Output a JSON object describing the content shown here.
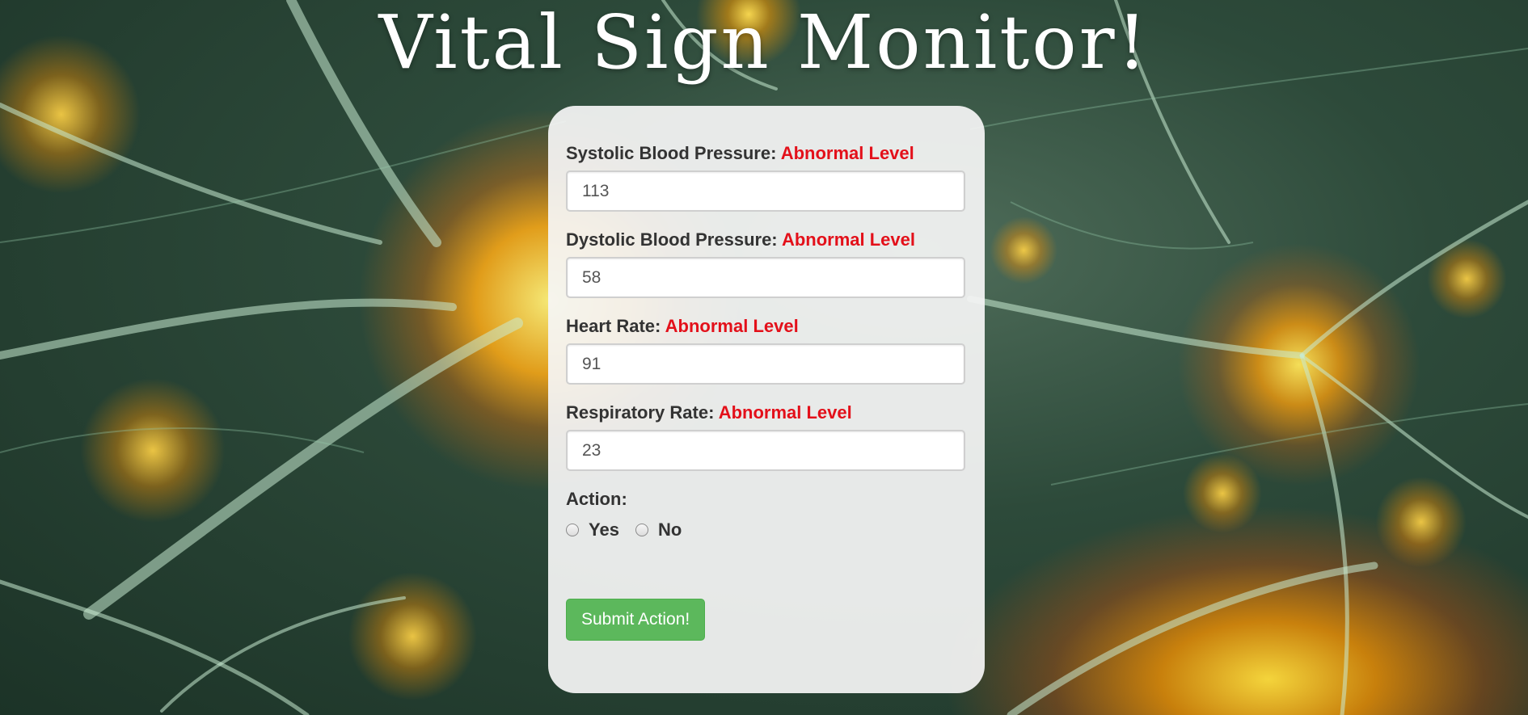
{
  "page": {
    "title": "Vital Sign Monitor!"
  },
  "form": {
    "fields": [
      {
        "label": "Systolic Blood Pressure:",
        "status": "Abnormal Level",
        "value": "113"
      },
      {
        "label": "Dystolic Blood Pressure:",
        "status": "Abnormal Level",
        "value": "58"
      },
      {
        "label": "Heart Rate:",
        "status": "Abnormal Level",
        "value": "91"
      },
      {
        "label": "Respiratory Rate:",
        "status": "Abnormal Level",
        "value": "23"
      }
    ],
    "action": {
      "label": "Action:",
      "options": [
        "Yes",
        "No"
      ],
      "selected": null
    },
    "submit_label": "Submit Action!"
  },
  "colors": {
    "status_abnormal": "#e3101a",
    "submit_button": "#5cb85c",
    "panel_background": "#f5f5f5"
  },
  "background": {
    "image": "neuron-illustration"
  }
}
